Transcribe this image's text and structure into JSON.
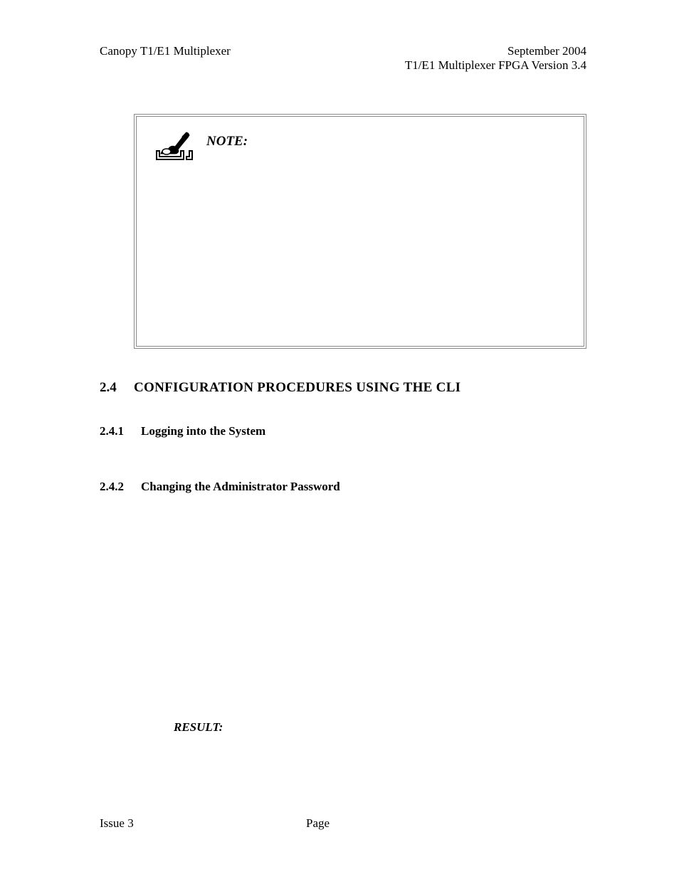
{
  "header": {
    "left": "Canopy T1/E1 Multiplexer",
    "right_line1": "September 2004",
    "right_line2": "T1/E1 Multiplexer FPGA Version 3.4"
  },
  "note": {
    "label": "NOTE:"
  },
  "section": {
    "number": "2.4",
    "title": "CONFIGURATION PROCEDURES USING THE CLI"
  },
  "subsections": [
    {
      "number": "2.4.1",
      "title": "Logging into the System"
    },
    {
      "number": "2.4.2",
      "title": "Changing the Administrator Password"
    }
  ],
  "result": {
    "label": "RESULT:"
  },
  "footer": {
    "left": "Issue 3",
    "center": "Page"
  }
}
